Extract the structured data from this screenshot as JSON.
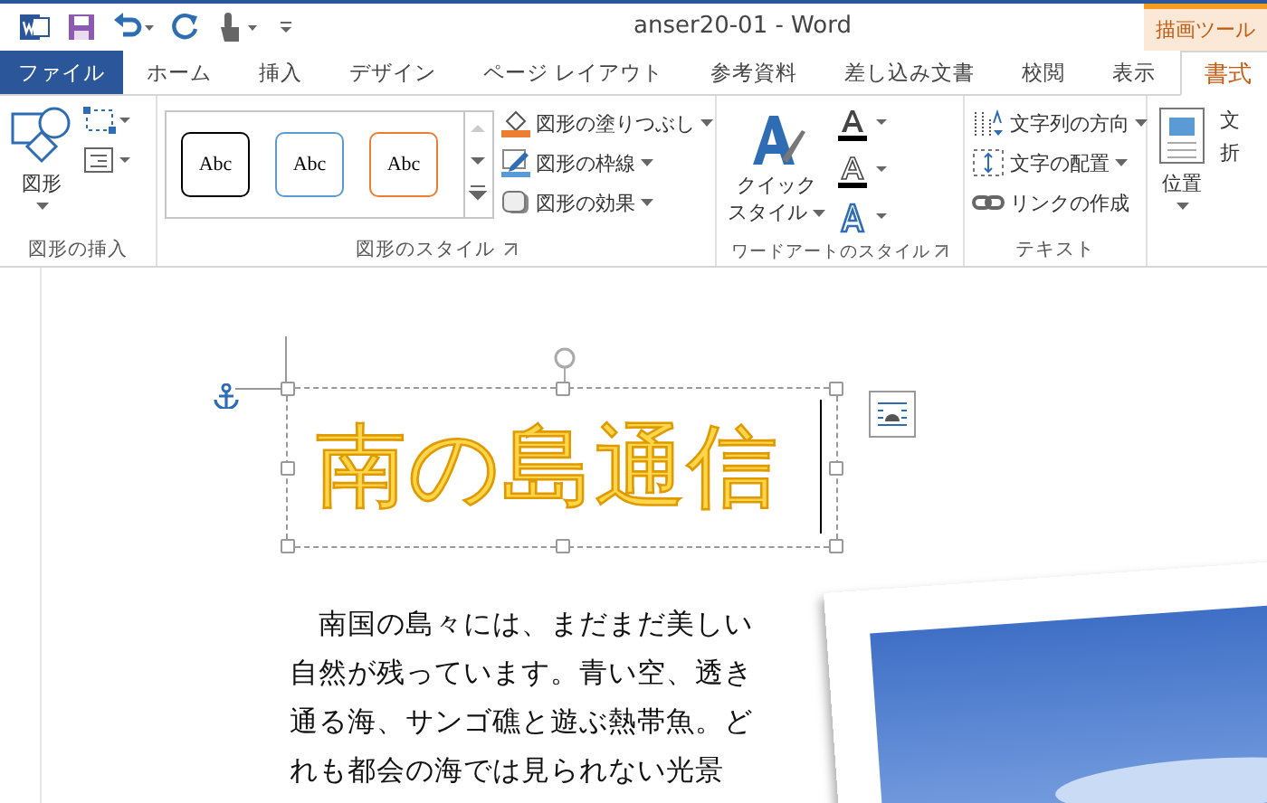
{
  "title_bar": {
    "title": "anser20-01 - Word",
    "context_label": "描画ツール"
  },
  "tabs": [
    {
      "label": "ファイル",
      "kind": "file",
      "selected": false
    },
    {
      "label": "ホーム",
      "kind": "tab",
      "selected": false
    },
    {
      "label": "挿入",
      "kind": "tab",
      "selected": false
    },
    {
      "label": "デザイン",
      "kind": "tab",
      "selected": false
    },
    {
      "label": "ページ レイアウト",
      "kind": "tab",
      "selected": false
    },
    {
      "label": "参考資料",
      "kind": "tab",
      "selected": false
    },
    {
      "label": "差し込み文書",
      "kind": "tab",
      "selected": false
    },
    {
      "label": "校閲",
      "kind": "tab",
      "selected": false
    },
    {
      "label": "表示",
      "kind": "tab",
      "selected": false
    },
    {
      "label": "書式",
      "kind": "context",
      "selected": true
    }
  ],
  "ribbon_groups": [
    {
      "kind": "insert",
      "label": "図形の挿入",
      "button": "図形",
      "launcher": false
    },
    {
      "kind": "styles",
      "label": "図形のスタイル",
      "launcher": true,
      "presets": [
        {
          "text": "Abc",
          "color": "#000000"
        },
        {
          "text": "Abc",
          "color": "#5b9bd5"
        },
        {
          "text": "Abc",
          "color": "#ed7d31"
        }
      ],
      "commands": [
        {
          "label": "図形の塗りつぶし",
          "dropdown": true
        },
        {
          "label": "図形の枠線",
          "dropdown": true
        },
        {
          "label": "図形の効果",
          "dropdown": true
        }
      ]
    },
    {
      "kind": "wordart",
      "label": "ワードアートのスタイル",
      "launcher": true,
      "button": [
        "クイック",
        "スタイル"
      ]
    },
    {
      "kind": "text",
      "label": "テキスト",
      "launcher": false,
      "commands": [
        {
          "label": "文字列の方向",
          "dropdown": true
        },
        {
          "label": "文字の配置",
          "dropdown": true
        },
        {
          "label": "リンクの作成",
          "dropdown": false
        }
      ]
    },
    {
      "kind": "arrange",
      "buttons": [
        {
          "lines": [
            "位置"
          ]
        },
        {
          "lines": [
            "文",
            "折"
          ]
        }
      ]
    }
  ],
  "document": {
    "heading": "南の島通信",
    "body_lines": [
      "南国の島々には、まだまだ美しい",
      "自然が残っています。青い空、透き",
      "通る海、サンゴ礁と遊ぶ熱帯魚。ど",
      "れも都会の海では見られない光景"
    ],
    "picture": {
      "kind": "picture"
    }
  }
}
